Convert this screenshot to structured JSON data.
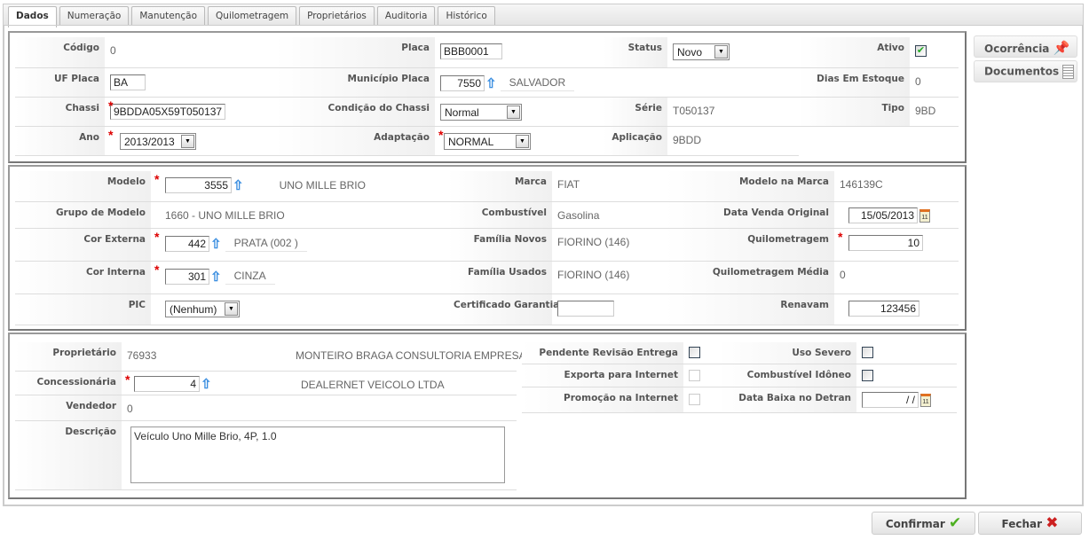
{
  "tabs": [
    "Dados",
    "Numeração",
    "Manutenção",
    "Quilometragem",
    "Proprietários",
    "Auditoria",
    "Histórico"
  ],
  "s1": {
    "codigo_label": "Código",
    "codigo": "0",
    "placa_label": "Placa",
    "placa": "BBB0001",
    "status_label": "Status",
    "status": "Novo",
    "ativo_label": "Ativo",
    "ativo": true,
    "uf_label": "UF Placa",
    "uf": "BA",
    "municipio_label": "Município Placa",
    "municipio_code": "7550",
    "municipio_name": "SALVADOR",
    "dias_label": "Dias Em Estoque",
    "dias": "0",
    "chassi_label": "Chassi",
    "chassi": "9BDDA05X59T050137",
    "condicao_label": "Condição do Chassi",
    "condicao": "Normal",
    "serie_label": "Série",
    "serie": "T050137",
    "tipo_label": "Tipo",
    "tipo": "9BD",
    "ano_label": "Ano",
    "ano": "2013/2013",
    "adaptacao_label": "Adaptação",
    "adaptacao": "NORMAL",
    "aplicacao_label": "Aplicação",
    "aplicacao": "9BDD"
  },
  "s2": {
    "modelo_label": "Modelo",
    "modelo_code": "3555",
    "modelo_name": "UNO MILLE BRIO",
    "marca_label": "Marca",
    "marca": "FIAT",
    "modelo_marca_label": "Modelo na Marca",
    "modelo_marca": "146139C",
    "grupo_label": "Grupo de Modelo",
    "grupo": "1660 - UNO MILLE BRIO",
    "combustivel_label": "Combustível",
    "combustivel": "Gasolina",
    "data_venda_label": "Data Venda Original",
    "data_venda": "15/05/2013",
    "cor_ext_label": "Cor Externa",
    "cor_ext_code": "442",
    "cor_ext_name": "PRATA (002 )",
    "fam_novos_label": "Família Novos",
    "fam_novos": "FIORINO (146)",
    "km_label": "Quilometragem",
    "km": "10",
    "cor_int_label": "Cor Interna",
    "cor_int_code": "301",
    "cor_int_name": "CINZA",
    "fam_usados_label": "Família Usados",
    "fam_usados": "FIORINO (146)",
    "km_media_label": "Quilometragem Média",
    "km_media": "0",
    "pic_label": "PIC",
    "pic": "(Nenhum)",
    "cert_label": "Certificado Garantia",
    "cert": "",
    "renavam_label": "Renavam",
    "renavam": "123456"
  },
  "s3": {
    "prop_label": "Proprietário",
    "prop_code": "76933",
    "prop_name": "MONTEIRO BRAGA CONSULTORIA EMPRESARIAL LTDA",
    "conc_label": "Concessionária",
    "conc_code": "4",
    "conc_name": "DEALERNET VEICOLO LTDA",
    "vend_label": "Vendedor",
    "vend": "0",
    "desc_label": "Descrição",
    "desc": "Veículo Uno Mille Brio, 4P, 1.0",
    "pend_label": "Pendente Revisão Entrega",
    "uso_label": "Uso Severo",
    "exporta_label": "Exporta para Internet",
    "comb_idoneo_label": "Combustível Idôneo",
    "promo_label": "Promoção na Internet",
    "baixa_label": "Data Baixa no Detran",
    "baixa": "  / /"
  },
  "side": {
    "ocorrencia": "Ocorrência",
    "documentos": "Documentos"
  },
  "footer": {
    "confirmar": "Confirmar",
    "fechar": "Fechar"
  },
  "colors": {
    "required": "#dd0000",
    "lookup_arrow": "#3a8ee0",
    "confirm": "#4caf20",
    "close": "#cc2020"
  }
}
